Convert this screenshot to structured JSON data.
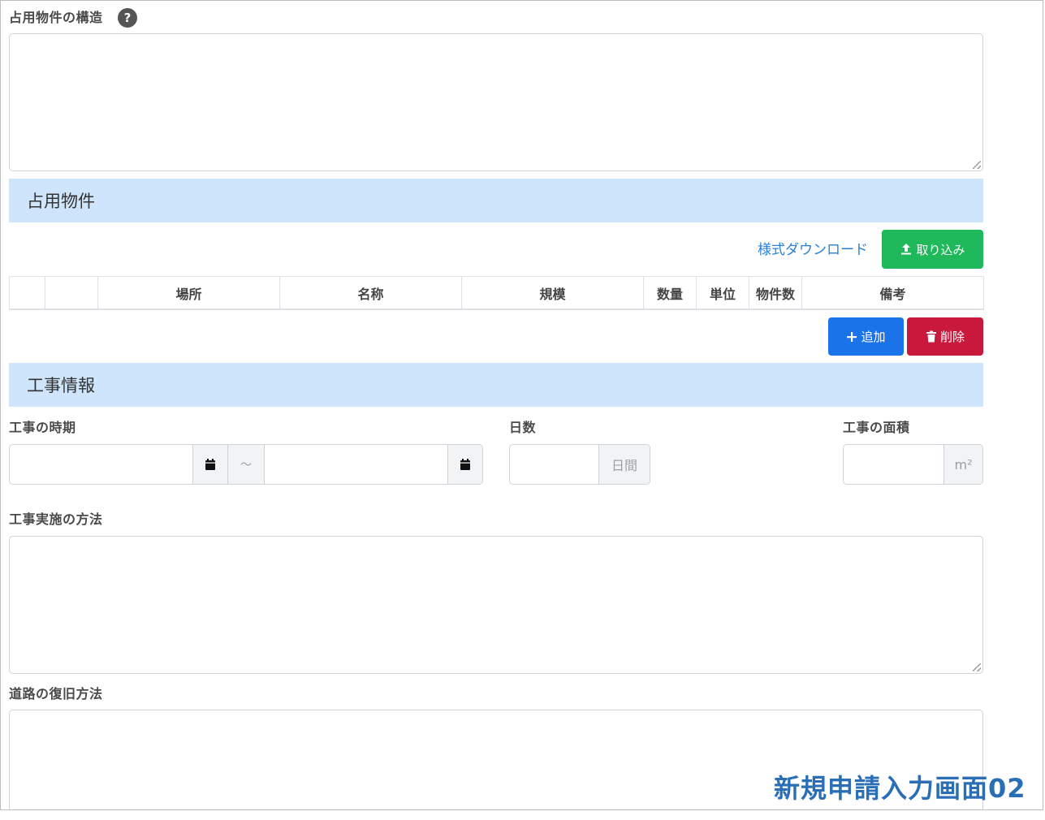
{
  "structure_section": {
    "label": "占用物件の構造",
    "help_symbol": "?"
  },
  "occupancy_header": "占用物件",
  "occupancy_toolbar": {
    "download_link": "様式ダウンロード",
    "import_button": "取り込み"
  },
  "occupancy_table": {
    "columns": [
      "",
      "",
      "場所",
      "名称",
      "規模",
      "数量",
      "単位",
      "物件数",
      "備考"
    ]
  },
  "row_actions": {
    "add_button": "追加",
    "delete_button": "削除"
  },
  "work_header": "工事情報",
  "work_period": {
    "label": "工事の時期",
    "separator": "～"
  },
  "days": {
    "label": "日数",
    "unit": "日間"
  },
  "area": {
    "label": "工事の面積",
    "unit": "m²"
  },
  "work_method": {
    "label": "工事実施の方法"
  },
  "restoration": {
    "label": "道路の復旧方法"
  },
  "caption": "新規申請入力画面02",
  "colors": {
    "section_bg": "#cfe5fb",
    "import_green": "#1fb85a",
    "add_blue": "#1a73e8",
    "delete_red": "#c8183c",
    "link_blue": "#2a7fd4",
    "caption_blue": "#2a6fb5"
  }
}
